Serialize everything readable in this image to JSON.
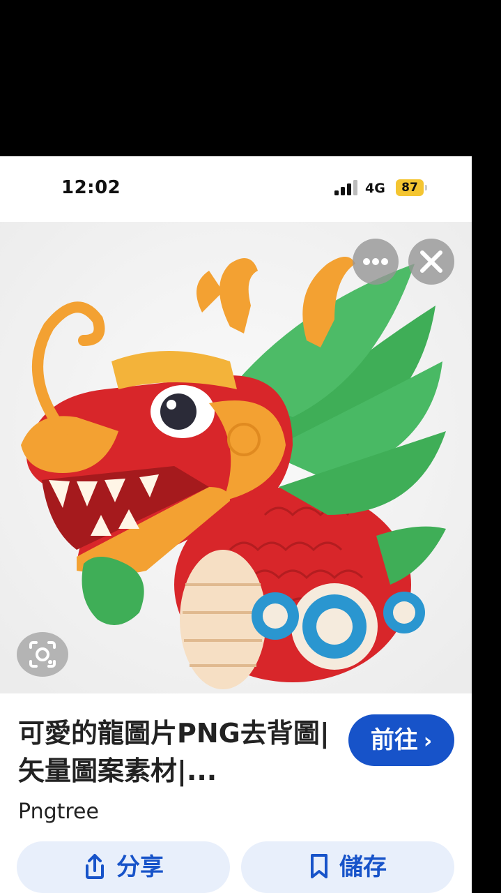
{
  "status_bar": {
    "time": "12:02",
    "network": "4G",
    "battery": "87",
    "battery_color": "#f4c531"
  },
  "image_viewer": {
    "more_icon": "more-horizontal-icon",
    "close_icon": "close-icon",
    "lens_icon": "visual-search-icon"
  },
  "result": {
    "title": "可愛的龍圖片PNG去背圖| 矢量圖案素材|...",
    "source": "Pngtree",
    "visit_label": "前往",
    "share_label": "分享",
    "save_label": "儲存",
    "accent_color": "#1753c9"
  }
}
